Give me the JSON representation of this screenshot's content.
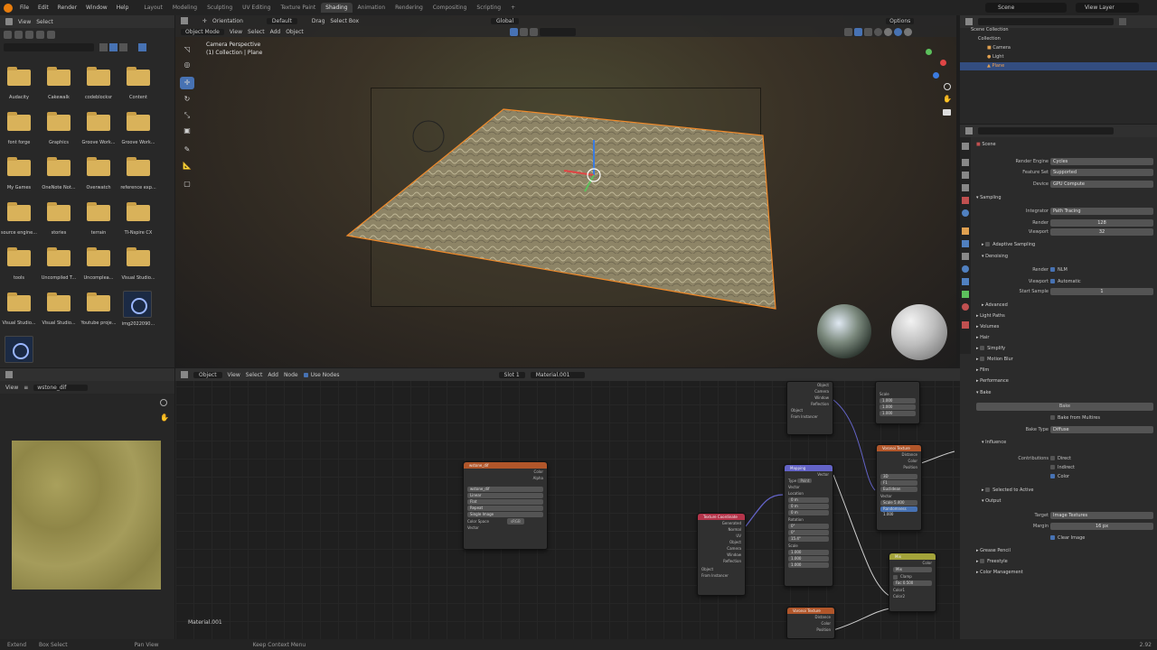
{
  "topbar": {
    "menus": [
      "File",
      "Edit",
      "Render",
      "Window",
      "Help"
    ],
    "workspaces": [
      "Layout",
      "Modeling",
      "Sculpting",
      "UV Editing",
      "Texture Paint",
      "Shading",
      "Animation",
      "Rendering",
      "Compositing",
      "Scripting"
    ],
    "active_workspace": "Shading",
    "scene": "Scene",
    "view_layer": "View Layer"
  },
  "file_browser": {
    "header": [
      "View",
      "Select"
    ],
    "folders": [
      "Audacity",
      "Cakewalk",
      "codeblocksr",
      "Content",
      "font forge",
      "Graphics",
      "Groove Work...",
      "Groove Work...",
      "My Games",
      "OneNote Not...",
      "Overwatch",
      "reference exp...",
      "source engine...",
      "stories",
      "terrain",
      "Tl-Nspire CX",
      "tools",
      "Uncompiled T...",
      "Uncomplea...",
      "Visual Studio...",
      "Visual Studio...",
      "Visual Studio...",
      "Youtube proje..."
    ],
    "image_file": "img2022090..."
  },
  "image_editor": {
    "view": "View",
    "image_name": "wstone_dif"
  },
  "viewport": {
    "mode": "Object Mode",
    "menus": [
      "View",
      "Select",
      "Add",
      "Object"
    ],
    "orientation_label": "Orientation",
    "orientation": "Default",
    "drag_label": "Drag",
    "drag_mode": "Select Box",
    "transform": "Global",
    "options": "Options",
    "camera_label": "Camera Perspective",
    "collection_label": "(1) Collection | Plane"
  },
  "node_editor": {
    "type": "Object",
    "menus": [
      "View",
      "Select",
      "Add",
      "Node"
    ],
    "use_nodes": "Use Nodes",
    "slot": "Slot 1",
    "material": "Material.001",
    "footer_material": "Material.001",
    "image_node": {
      "title": "wstone_dif",
      "outputs": [
        "Color",
        "Alpha"
      ],
      "image": "wstone_dif",
      "fields": [
        "Linear",
        "Flat",
        "Repeat",
        "Single Image"
      ],
      "color_space_label": "Color Space",
      "color_space": "sRGB",
      "vector": "Vector"
    },
    "texcoord_node": {
      "title": "Texture Coordinate",
      "outputs": [
        "Generated",
        "Normal",
        "UV",
        "Object",
        "Camera",
        "Window",
        "Reflection"
      ],
      "object_label": "Object",
      "from_instancer": "From Instancer"
    },
    "mapping_node": {
      "title": "Mapping",
      "vector_out": "Vector",
      "type_label": "Type",
      "type": "Point",
      "vector_in": "Vector",
      "location": "Location",
      "location_values": [
        "0 m",
        "0 m",
        "0 m"
      ],
      "rotation": "Rotation",
      "rotation_values": [
        "0°",
        "0°",
        "15.4°"
      ],
      "scale": "Scale",
      "scale_values": [
        "1.000",
        "1.000",
        "1.000"
      ]
    },
    "top_node": {
      "outputs": [
        "Object",
        "Camera",
        "Window",
        "Reflection"
      ],
      "object_label": "Object",
      "from_instancer": "From Instancer"
    },
    "scale_node": {
      "scale_label": "Scale",
      "values": [
        "1.000",
        "1.000",
        "1.000"
      ]
    },
    "voronoi_node": {
      "title": "Voronoi Texture",
      "outputs": [
        "Distance",
        "Color",
        "Position"
      ],
      "fields": [
        "3D",
        "F1",
        "Euclidean"
      ],
      "vector": "Vector",
      "scale_label": "Scale",
      "scale_value": "5.400",
      "randomness_label": "Randomness",
      "randomness_value": "1.000"
    },
    "mix_node": {
      "title": "Mix",
      "output": "Color",
      "blend": "Mix",
      "clamp": "Clamp",
      "fac_label": "Fac",
      "fac_value": "0.500",
      "inputs": [
        "Color1",
        "Color2"
      ]
    },
    "bottom_node": {
      "title": "Voronoi Texture",
      "outputs": [
        "Distance",
        "Color",
        "Position"
      ]
    }
  },
  "outliner": {
    "scene_collection": "Scene Collection",
    "collection": "Collection",
    "items": [
      "Camera",
      "Light",
      "Plane"
    ]
  },
  "properties": {
    "scene": "Scene",
    "render_engine_label": "Render Engine",
    "render_engine": "Cycles",
    "feature_set_label": "Feature Set",
    "feature_set": "Supported",
    "device_label": "Device",
    "device": "GPU Compute",
    "sampling": "Sampling",
    "integrator_label": "Integrator",
    "integrator": "Path Tracing",
    "render_label": "Render",
    "render_samples": "128",
    "viewport_label": "Viewport",
    "viewport_samples": "32",
    "adaptive_sampling": "Adaptive Sampling",
    "denoising": "Denoising",
    "denoise_render": "NLM",
    "denoise_viewport": "Automatic",
    "start_sample_label": "Start Sample",
    "start_sample": "1",
    "sections": [
      "Advanced",
      "Light Paths",
      "Volumes",
      "Hair",
      "Simplify",
      "Motion Blur",
      "Film",
      "Performance",
      "Bake"
    ],
    "bake_button": "Bake",
    "bake_from_multires": "Bake from Multires",
    "bake_type_label": "Bake Type",
    "bake_type": "Diffuse",
    "influence": "Influence",
    "contributions_label": "Contributions",
    "contributions": [
      "Direct",
      "Indirect",
      "Color"
    ],
    "selected_to_active": "Selected to Active",
    "output": "Output",
    "target_label": "Target",
    "target": "Image Textures",
    "margin_label": "Margin",
    "margin": "16 px",
    "clear_image": "Clear Image",
    "bottom_sections": [
      "Grease Pencil",
      "Freestyle",
      "Color Management"
    ]
  },
  "statusbar": {
    "items": [
      "Extend",
      "Box Select",
      "Pan View",
      "Keep Context Menu"
    ],
    "version": "2.92"
  },
  "colors": {
    "accent": "#4772b3",
    "selection": "#f08a2a",
    "folder": "#d9b25a"
  }
}
